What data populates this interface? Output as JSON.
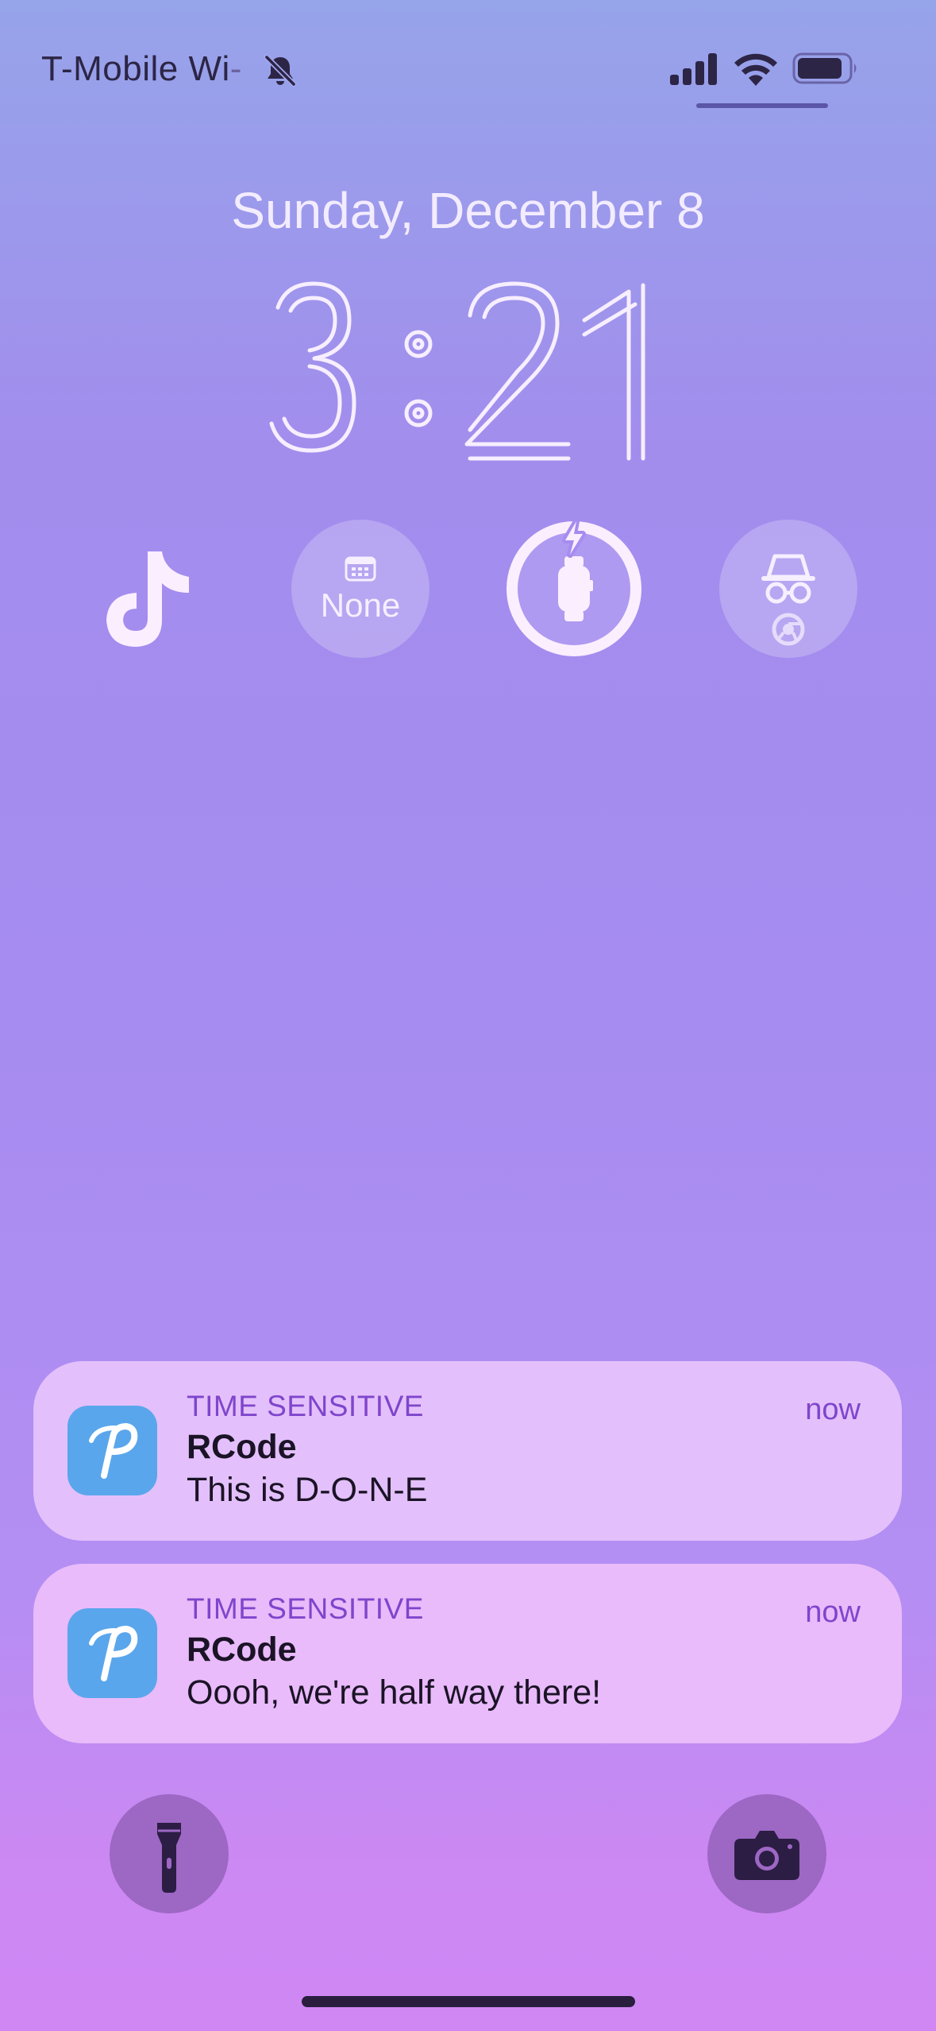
{
  "status_bar": {
    "carrier": "T-Mobile Wi",
    "carrier_trailing": "-",
    "icons": [
      "bell-slash-icon",
      "cellular-signal-icon",
      "wifi-icon",
      "battery-icon"
    ]
  },
  "lock_screen": {
    "date": "Sunday, December 8",
    "time": "3:21"
  },
  "widgets": [
    {
      "name": "tiktok",
      "icon": "tiktok-icon"
    },
    {
      "name": "calendar",
      "icon": "calendar-icon",
      "label": "None"
    },
    {
      "name": "watch-battery",
      "icon": "apple-watch-icon",
      "charging": true
    },
    {
      "name": "incognito",
      "icon": "incognito-icon",
      "secondary_icon": "chrome-icon"
    }
  ],
  "notifications": [
    {
      "category": "TIME SENSITIVE",
      "app": "RCode",
      "body": "This is D-O-N-E",
      "time": "now",
      "icon": "rcode-app-icon"
    },
    {
      "category": "TIME SENSITIVE",
      "app": "RCode",
      "body": "Oooh, we're half way there!",
      "time": "now",
      "icon": "rcode-app-icon"
    }
  ],
  "bottom_controls": {
    "left": "flashlight-icon",
    "right": "camera-icon"
  },
  "colors": {
    "accent": "#7f45cc",
    "app_icon": "#5aa6ec",
    "clock": "#f7eeff"
  }
}
